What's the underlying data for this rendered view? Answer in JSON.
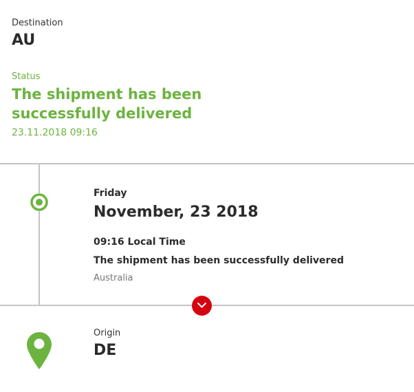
{
  "destination": {
    "label": "Destination",
    "value": "AU"
  },
  "status": {
    "label": "Status",
    "headline": "The shipment has been successfully delivered",
    "datetime": "23.11.2018 09:16"
  },
  "event": {
    "weekday": "Friday",
    "date": "November, 23 2018",
    "time": "09:16 Local Time",
    "description": "The shipment has been successfully delivered",
    "location": "Australia",
    "icon": "target-dot-icon"
  },
  "expand": {
    "icon": "chevron-down-icon"
  },
  "origin": {
    "label": "Origin",
    "value": "DE",
    "icon": "map-pin-icon"
  },
  "colors": {
    "status_green": "#6cb33f",
    "accent_red": "#d40511",
    "divider_gray": "#c4c4c4",
    "text_dark": "#2b2b2b"
  }
}
